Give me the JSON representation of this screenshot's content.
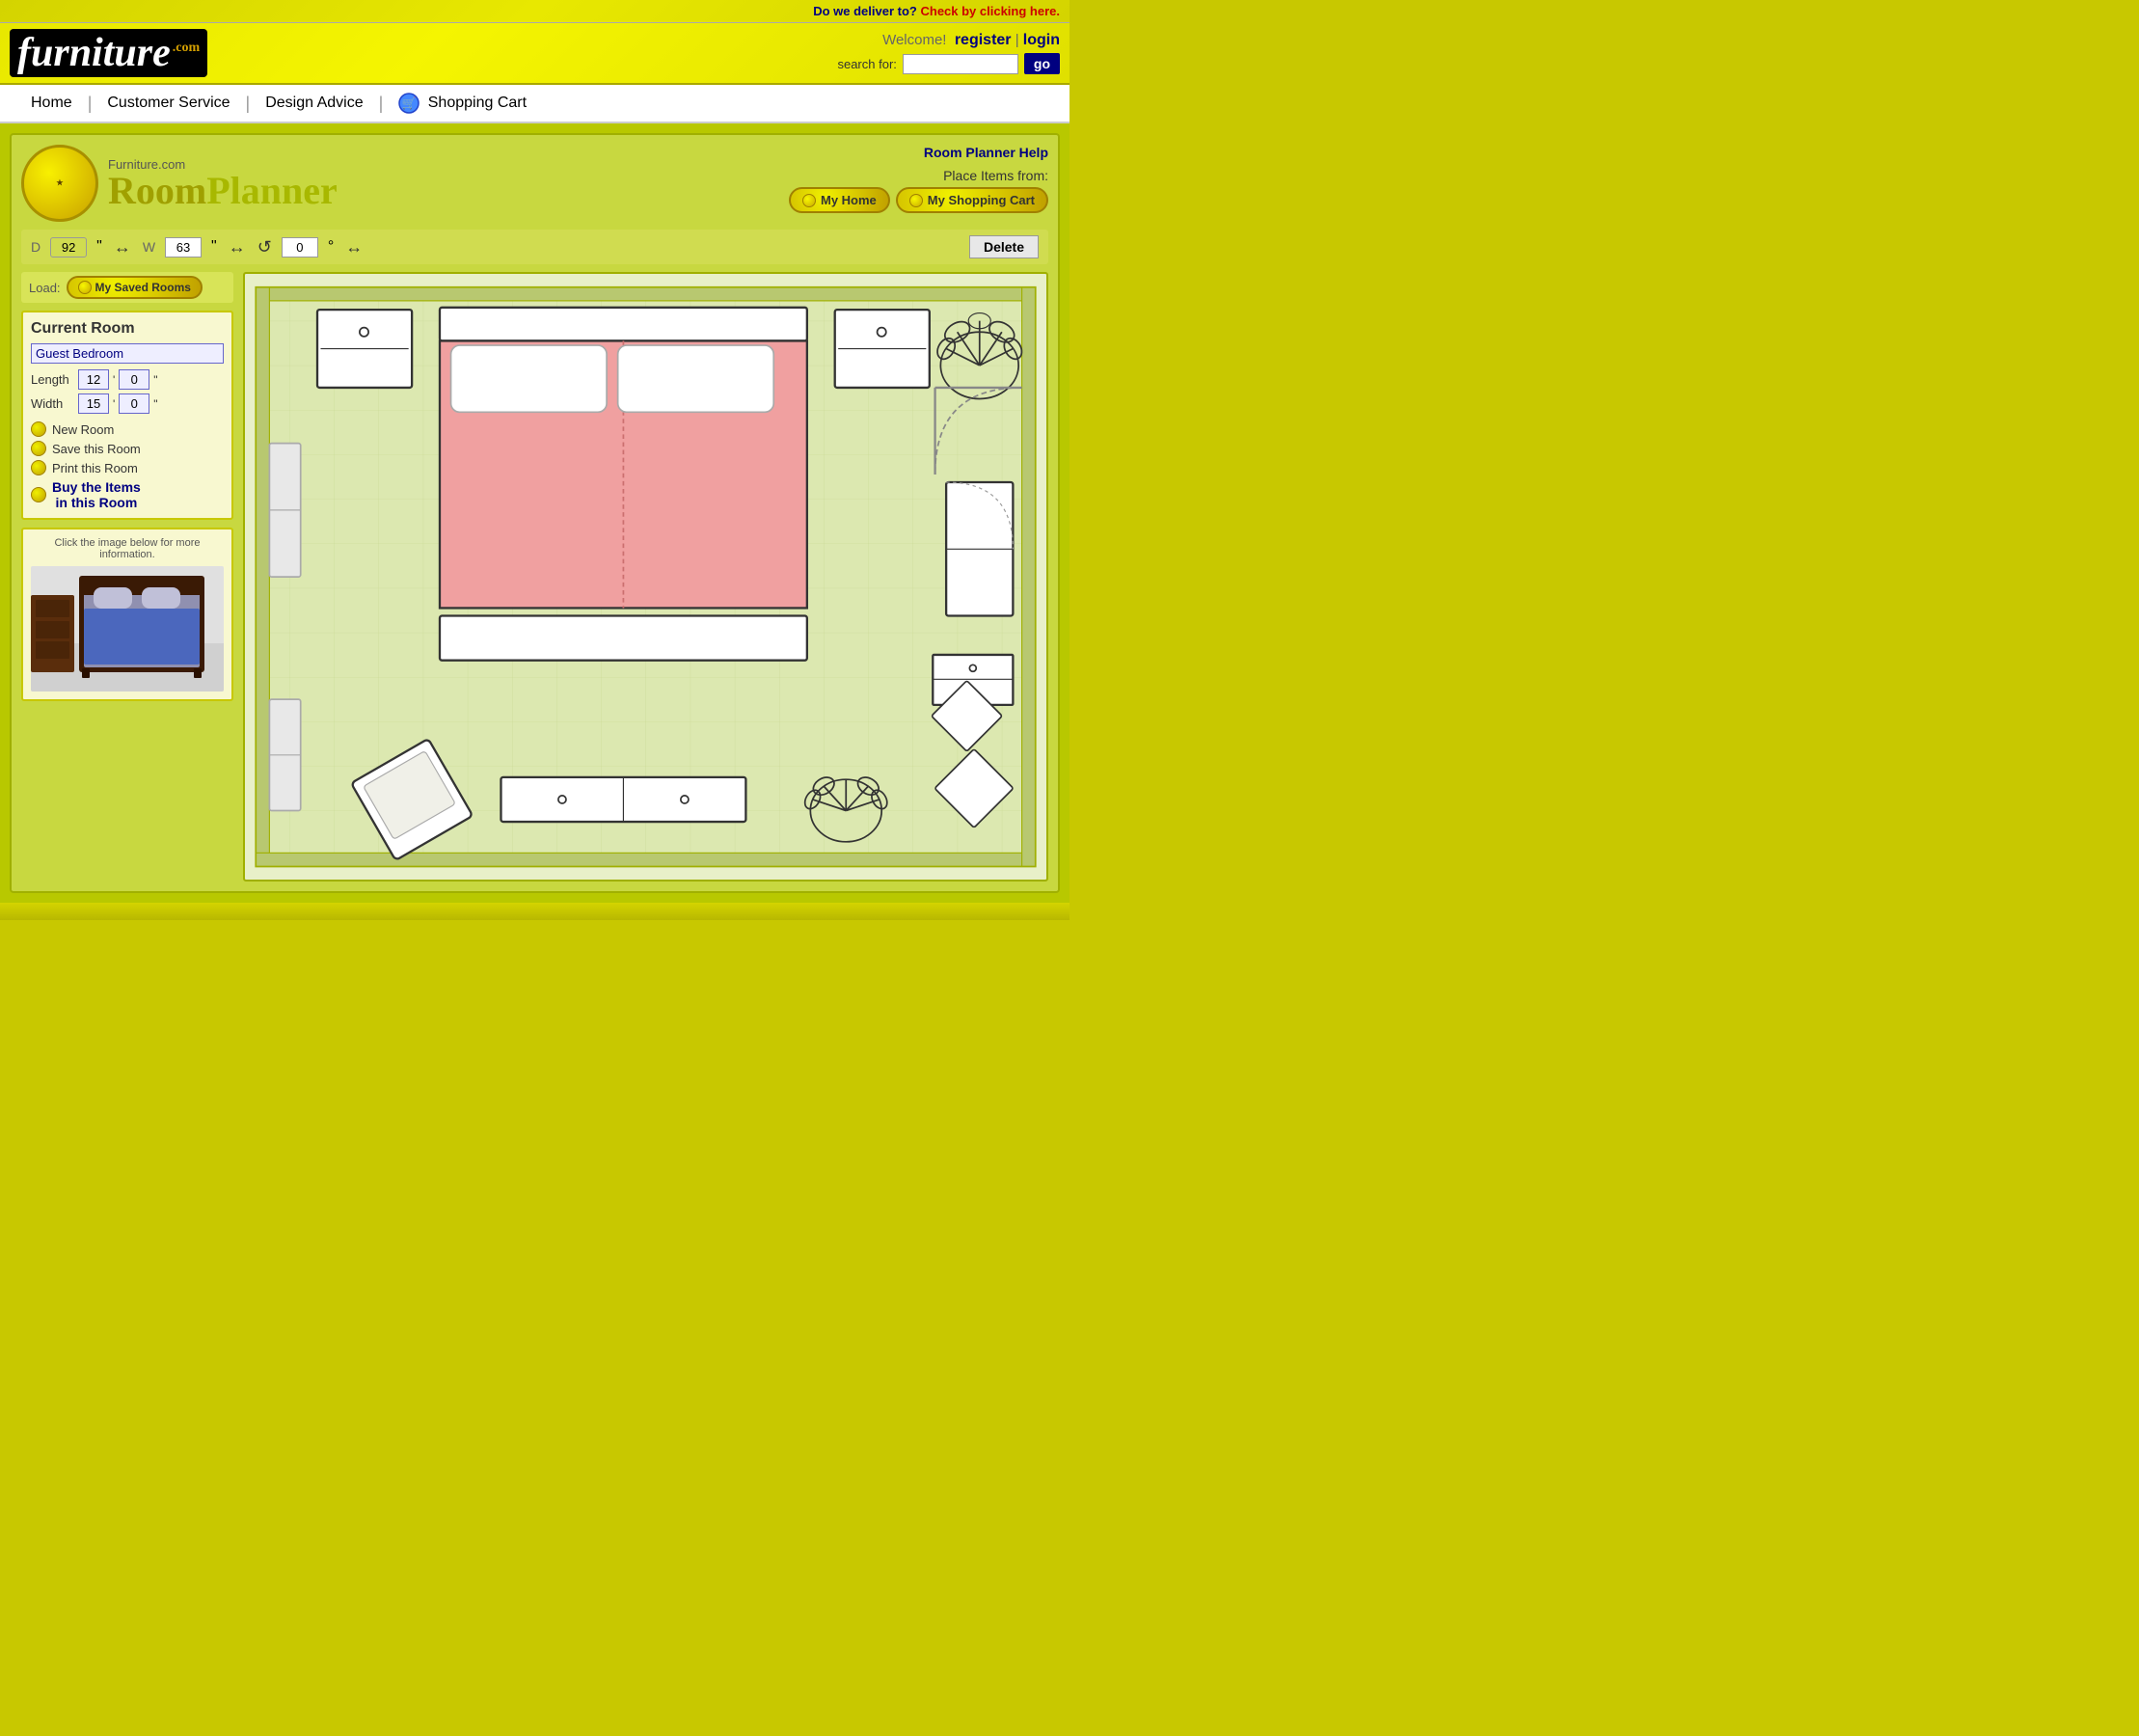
{
  "delivery": {
    "question": "Do we deliver to?",
    "link_text": "Check by clicking here."
  },
  "header": {
    "logo_furniture": "furniture",
    "logo_com": ".com",
    "welcome_text": "Welcome!",
    "register_label": "register",
    "login_label": "login",
    "separator": "|",
    "search_label": "search for:",
    "search_placeholder": "",
    "go_label": "go"
  },
  "nav": {
    "home": "Home",
    "customer_service": "Customer Service",
    "design_advice": "Design Advice",
    "shopping_cart": "Shopping Cart"
  },
  "planner": {
    "help_link": "Room Planner Help",
    "logo_small": "Furniture.com",
    "logo_big1": "Room",
    "logo_big2": "Planner",
    "place_items_label": "Place Items from:",
    "my_home_btn": "My Home",
    "my_cart_btn": "My Shopping Cart",
    "toolbar": {
      "d_label": "D",
      "d_value": "92",
      "d_unit": "\"",
      "w_label": "W",
      "w_value": "63",
      "w_unit": "\"",
      "rotate_value": "0",
      "rotate_unit": "°",
      "delete_label": "Delete"
    },
    "sidebar": {
      "load_label": "Load:",
      "my_saved_rooms": "My Saved Rooms",
      "current_room_title": "Current Room",
      "room_name": "Guest Bedroom",
      "length_label": "Length",
      "length_ft": "12",
      "length_in": "0",
      "width_label": "Width",
      "width_ft": "15",
      "width_in": "0",
      "new_room": "New Room",
      "save_room": "Save this Room",
      "print_room": "Print this Room",
      "buy_items": "Buy the Items\nin this Room",
      "info_title": "Click the image below for more information."
    }
  }
}
